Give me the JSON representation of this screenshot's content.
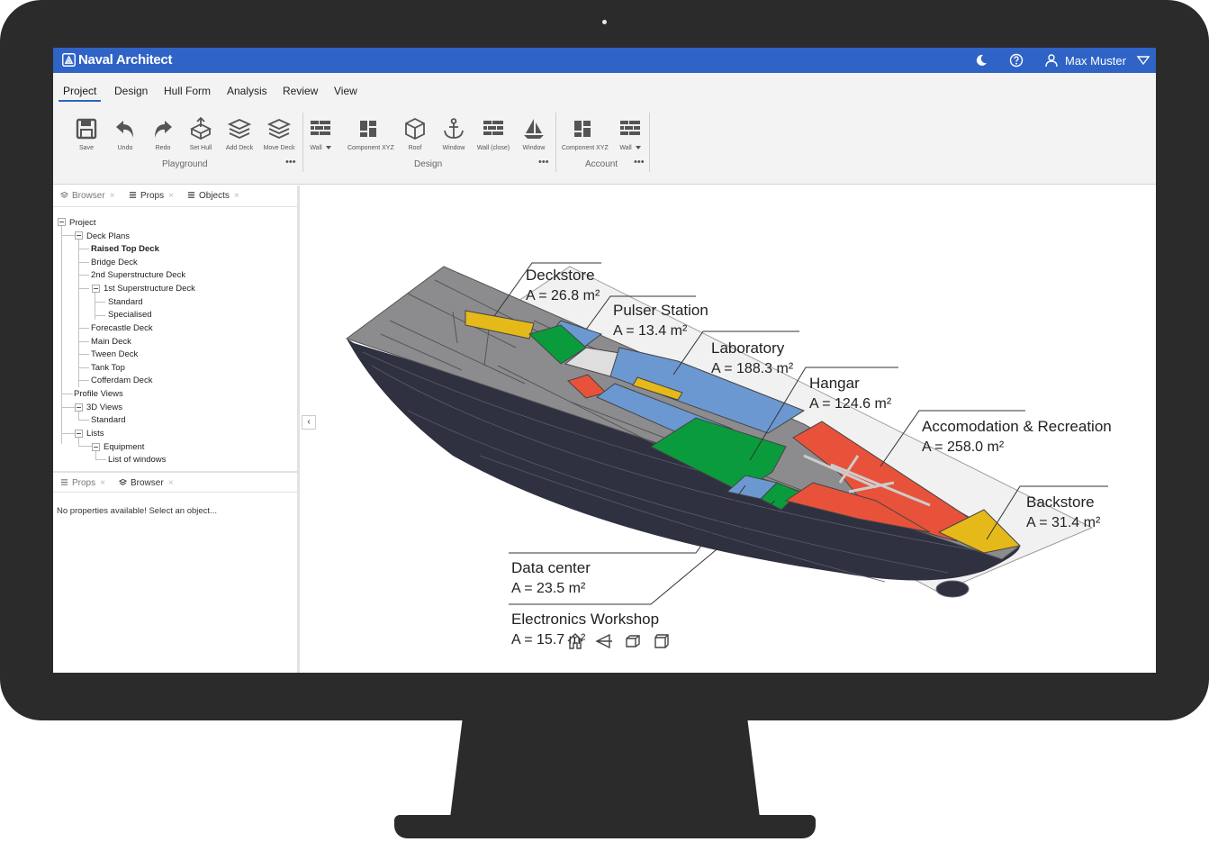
{
  "window": {
    "app_title": "Naval Architect",
    "user_name": "Max Muster",
    "icons": [
      "app-logo-icon",
      "moon-icon",
      "help-icon",
      "user-icon",
      "dropdown-triangle-icon"
    ]
  },
  "menu": {
    "tabs": [
      "Project",
      "Design",
      "Hull Form",
      "Analysis",
      "Review",
      "View"
    ],
    "active": "Project"
  },
  "ribbon": {
    "groups": [
      {
        "label": "Playground",
        "more": "•••"
      },
      {
        "label": "Design",
        "more": "•••"
      },
      {
        "label": "Account",
        "more": "•••"
      }
    ],
    "buttons": [
      {
        "label": "Save",
        "icon": "floppy-disk-icon"
      },
      {
        "label": "Undo",
        "icon": "undo-arrow-icon"
      },
      {
        "label": "Redo",
        "icon": "redo-arrow-icon"
      },
      {
        "label": "Set Hull",
        "icon": "hull-box-icon"
      },
      {
        "label": "Add Deck",
        "icon": "layers-icon"
      },
      {
        "label": "Move Deck",
        "icon": "layers-icon"
      },
      {
        "label": "Wall",
        "icon": "brick-wall-icon"
      },
      {
        "label": "Component XYZ",
        "icon": "dashboard-icon"
      },
      {
        "label": "Roof",
        "icon": "cube-icon"
      },
      {
        "label": "Window",
        "icon": "anchor-icon"
      },
      {
        "label": "Wall (close)",
        "icon": "brick-wall-icon"
      },
      {
        "label": "Window",
        "icon": "sailboat-icon"
      },
      {
        "label": "Component XYZ",
        "icon": "dashboard-icon"
      },
      {
        "label": "Wall",
        "icon": "brick-wall-icon"
      }
    ]
  },
  "upper_panel": {
    "tabs": [
      {
        "label": "Browser",
        "icon": "layers-icon",
        "close": "×"
      },
      {
        "label": "Props",
        "icon": "list-icon",
        "close": "×"
      },
      {
        "label": "Objects",
        "icon": "list-icon",
        "close": "×"
      }
    ],
    "tree": [
      "Project",
      "Deck Plans",
      "Raised Top Deck",
      "Bridge Deck",
      "2nd Superstructure Deck",
      "1st Superstructure Deck",
      "Standard",
      "Specialised",
      "Forecastle Deck",
      "Main Deck",
      "Tween Deck",
      "Tank Top",
      "Cofferdam Deck",
      "Profile Views",
      "3D Views",
      "Standard",
      "Lists",
      "Equipment",
      "List of windows"
    ]
  },
  "lower_panel": {
    "tabs": [
      {
        "label": "Props",
        "icon": "list-icon",
        "close": "×"
      },
      {
        "label": "Browser",
        "icon": "layers-icon",
        "close": ""
      }
    ],
    "message": "No properties available! Select an object..."
  },
  "viewport": {
    "collapse_glyph": "‹",
    "annotations": [
      {
        "name": "Deckstore",
        "area": "A = 26.8 m²"
      },
      {
        "name": "Pulser Station",
        "area": "A = 13.4 m²"
      },
      {
        "name": "Laboratory",
        "area": "A = 188.3 m²"
      },
      {
        "name": "Hangar",
        "area": "A = 124.6 m²"
      },
      {
        "name": "Accomodation & Recreation",
        "area": "A = 258.0 m²"
      },
      {
        "name": "Backstore",
        "area": "A = 31.4 m²"
      },
      {
        "name": "Data center",
        "area": "A = 23.5 m²"
      },
      {
        "name": "Electronics Workshop",
        "area": "A = 15.7 m²"
      }
    ],
    "nav_icons": [
      "home-icon",
      "side-view-icon",
      "top-view-icon",
      "iso-view-icon"
    ],
    "colors": {
      "hull": "#2f3040",
      "deck_grey": "#8c8c8f",
      "blue": "#6c98d1",
      "green": "#0a9c3c",
      "red": "#e8523a",
      "yellow": "#e5b91a",
      "white": "#dedede"
    }
  }
}
